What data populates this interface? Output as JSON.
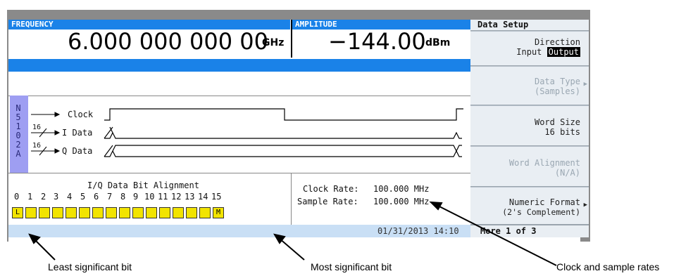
{
  "frequency": {
    "label": "FREQUENCY",
    "value": "6.000 000 000 00",
    "unit": "GHz"
  },
  "amplitude": {
    "label": "AMPLITUDE",
    "value": "−144.00",
    "unit": "dBm"
  },
  "device_tag": [
    "N",
    "5",
    "1",
    "0",
    "2",
    "A"
  ],
  "signals": [
    {
      "name": "Clock",
      "width": ""
    },
    {
      "name": "I Data",
      "width": "16"
    },
    {
      "name": "Q Data",
      "width": "16"
    }
  ],
  "bit_alignment": {
    "title": "I/Q Data Bit Alignment",
    "bits": [
      "0",
      "1",
      "2",
      "3",
      "4",
      "5",
      "6",
      "7",
      "8",
      "9",
      "10",
      "11",
      "12",
      "13",
      "14",
      "15"
    ],
    "lsb_marker": "L",
    "msb_marker": "M"
  },
  "rates": {
    "clock_label": "Clock Rate:",
    "clock_value": "100.000 MHz",
    "sample_label": "Sample Rate:",
    "sample_value": "100.000 MHz"
  },
  "datetime": "01/31/2013 14:10",
  "softkeys": {
    "title": "Data Setup",
    "direction": {
      "line1": "Direction",
      "input": "Input",
      "output": "Output"
    },
    "data_type": {
      "line1": "Data Type",
      "line2": "(Samples)"
    },
    "word_size": {
      "line1": "Word Size",
      "line2": "16 bits"
    },
    "word_alignment": {
      "line1": "Word Alignment",
      "line2": "(N/A)"
    },
    "numeric_format": {
      "line1": "Numeric Format",
      "line2": "(2's Complement)"
    },
    "more": "More 1 of 3"
  },
  "annotations": {
    "lsb": "Least significant bit",
    "msb": "Most significant bit",
    "rates": "Clock and sample rates"
  }
}
